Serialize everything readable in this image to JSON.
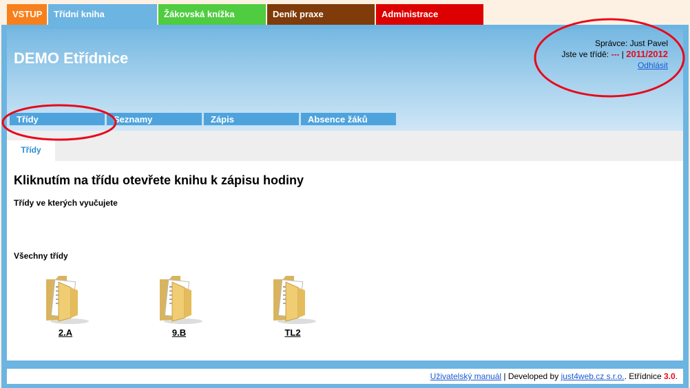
{
  "top_tabs": [
    {
      "label": "VSTUP",
      "color": "#f7801d"
    },
    {
      "label": "Třídní kniha",
      "color": "#6cb4e2"
    },
    {
      "label": "Žákovská knížka",
      "color": "#4fcc3f"
    },
    {
      "label": "Deník praxe",
      "color": "#7f3b0a"
    },
    {
      "label": "Administrace",
      "color": "#dd0000"
    }
  ],
  "header": {
    "title": "DEMO Etřídnice",
    "admin_label": "Správce: Just Pavel",
    "class_label": "Jste ve třídě:",
    "class_value": "---",
    "separator": "|",
    "school_year": "2011/2012",
    "logout": "Odhlásit"
  },
  "subnav": [
    "Třídy",
    "Seznamy",
    "Zápis",
    "Absence žáků"
  ],
  "inner_tab": "Třídy",
  "main": {
    "heading": "Kliknutím na třídu otevřete knihu k zápisu hodiny",
    "section_teaching": "Třídy ve kterých vyučujete",
    "section_all": "Všechny třídy",
    "classes": [
      "2.A",
      "9.B",
      "TL2"
    ]
  },
  "footer": {
    "manual_link": "Uživatelský manuál",
    "developed_by": " | Developed by ",
    "dev_link": "just4web.cz s.r.o.",
    "app_name": ". Etřídnice ",
    "version": "3.0",
    "version_suffix": "."
  },
  "colors": {
    "annotation": "#e8081a",
    "link": "#1a5ad2",
    "frame": "#6cb4e2",
    "subnav": "#4ea3dd"
  },
  "icons": {
    "class_folder": "folder-icon"
  }
}
